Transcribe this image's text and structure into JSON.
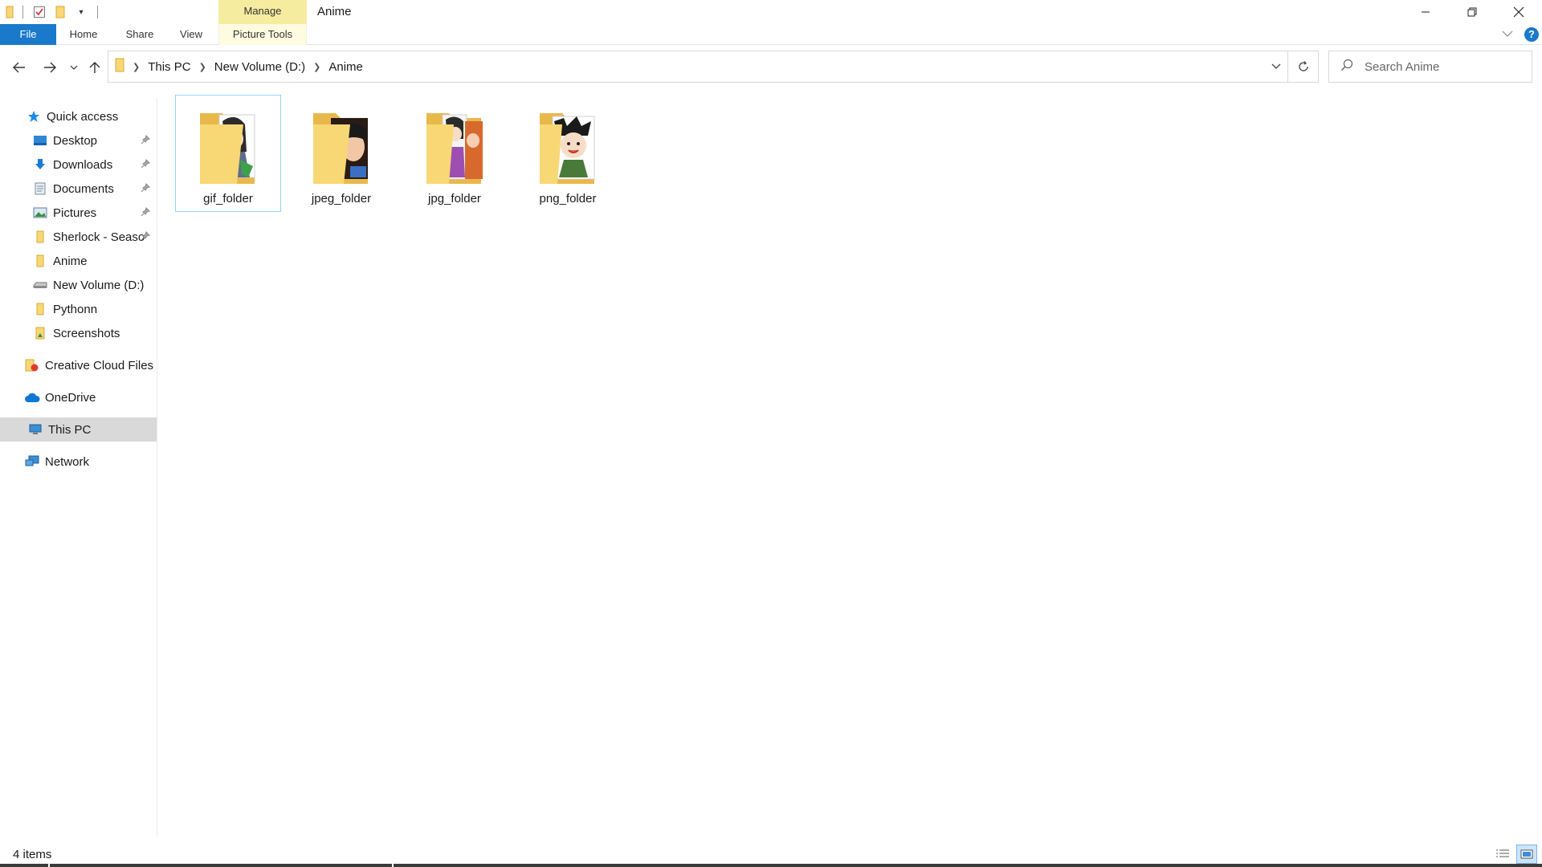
{
  "window": {
    "title": "Anime",
    "contextual_tab": "Manage"
  },
  "ribbon": {
    "tabs": [
      "File",
      "Home",
      "Share",
      "View",
      "Picture Tools"
    ],
    "help": "?"
  },
  "address": {
    "crumbs": [
      "This PC",
      "New Volume (D:)",
      "Anime"
    ]
  },
  "search": {
    "placeholder": "Search Anime"
  },
  "sidebar": {
    "quick_access": "Quick access",
    "pinned": [
      {
        "label": "Desktop",
        "icon": "desktop-icon"
      },
      {
        "label": "Downloads",
        "icon": "download-icon"
      },
      {
        "label": "Documents",
        "icon": "documents-icon"
      },
      {
        "label": "Pictures",
        "icon": "pictures-icon"
      },
      {
        "label": "Sherlock - Seaso",
        "icon": "folder-icon"
      }
    ],
    "recent": [
      {
        "label": "Anime",
        "icon": "folder-icon"
      },
      {
        "label": "New Volume (D:)",
        "icon": "drive-icon"
      },
      {
        "label": "Pythonn",
        "icon": "folder-icon"
      },
      {
        "label": "Screenshots",
        "icon": "screenshots-folder-icon"
      }
    ],
    "creative_cloud": "Creative Cloud Files",
    "onedrive": "OneDrive",
    "this_pc": "This PC",
    "network": "Network"
  },
  "files": [
    {
      "name": "gif_folder",
      "selected": true
    },
    {
      "name": "jpeg_folder",
      "selected": false
    },
    {
      "name": "jpg_folder",
      "selected": false
    },
    {
      "name": "png_folder",
      "selected": false
    }
  ],
  "status": {
    "item_count": "4 items"
  },
  "colors": {
    "accent": "#1979ca",
    "manage_tab": "#f6ec9f",
    "selection_border": "#99d1ff",
    "sidebar_selected": "#d9d9d9",
    "folder": "#f8d775"
  }
}
